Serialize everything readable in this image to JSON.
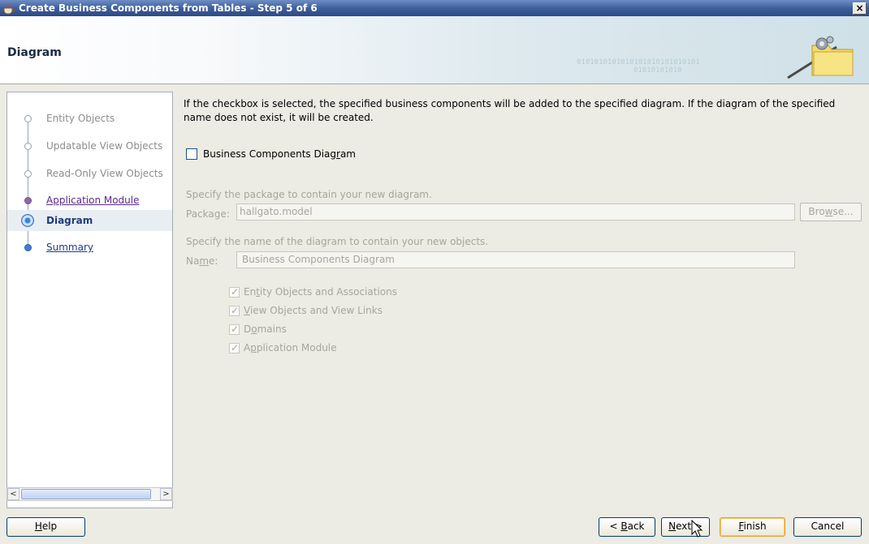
{
  "window": {
    "title": "Create Business Components from Tables - Step 5 of 6",
    "close_label": "×"
  },
  "banner": {
    "title": "Diagram",
    "binary_text": "0101010101010101010101010101",
    "binary_text_2": "01010101010"
  },
  "nav": {
    "items": [
      {
        "label": "Entity Objects",
        "state": "done"
      },
      {
        "label": "Updatable View Objects",
        "state": "done"
      },
      {
        "label": "Read-Only View Objects",
        "state": "done"
      },
      {
        "label": "Application Module",
        "state": "visited"
      },
      {
        "label": "Diagram",
        "state": "current"
      },
      {
        "label": "Summary",
        "state": "todo"
      }
    ],
    "scroll_left": "<",
    "scroll_right": ">"
  },
  "main": {
    "description": "If the checkbox is selected, the specified business components will be added to the specified diagram.  If the diagram of the specified name does not exist, it will be created.",
    "diagram_checkbox": {
      "label_pre": "Business Components Diag",
      "label_mn": "r",
      "label_post": "am",
      "checked": false
    },
    "package_hint": "Specify the package to contain your new diagram.",
    "package_label": "Package:",
    "package_value": "hallgato.model",
    "browse_pre": "Bro",
    "browse_mn": "w",
    "browse_post": "se...",
    "name_hint": "Specify the name of the diagram to contain your new objects.",
    "name_label_pre": "Na",
    "name_label_mn": "m",
    "name_label_post": "e:",
    "name_value": "Business Components Diagram",
    "options": [
      {
        "pre": "En",
        "mn": "t",
        "post": "ity Objects and Associations",
        "checked": true
      },
      {
        "pre": "",
        "mn": "V",
        "post": "iew Objects and View Links",
        "checked": true
      },
      {
        "pre": "D",
        "mn": "o",
        "post": "mains",
        "checked": true
      },
      {
        "pre": "A",
        "mn": "p",
        "post": "plication Module",
        "checked": true
      }
    ]
  },
  "buttons": {
    "help_mn": "H",
    "help_post": "elp",
    "back_pre": "< ",
    "back_mn": "B",
    "back_post": "ack",
    "next_mn": "N",
    "next_post": "ext >",
    "finish_mn": "F",
    "finish_post": "inish",
    "cancel": "Cancel"
  },
  "colors": {
    "titlebar": "#3f5f9c",
    "accent": "#3f7fd2",
    "disabled_text": "#a7a69d"
  }
}
